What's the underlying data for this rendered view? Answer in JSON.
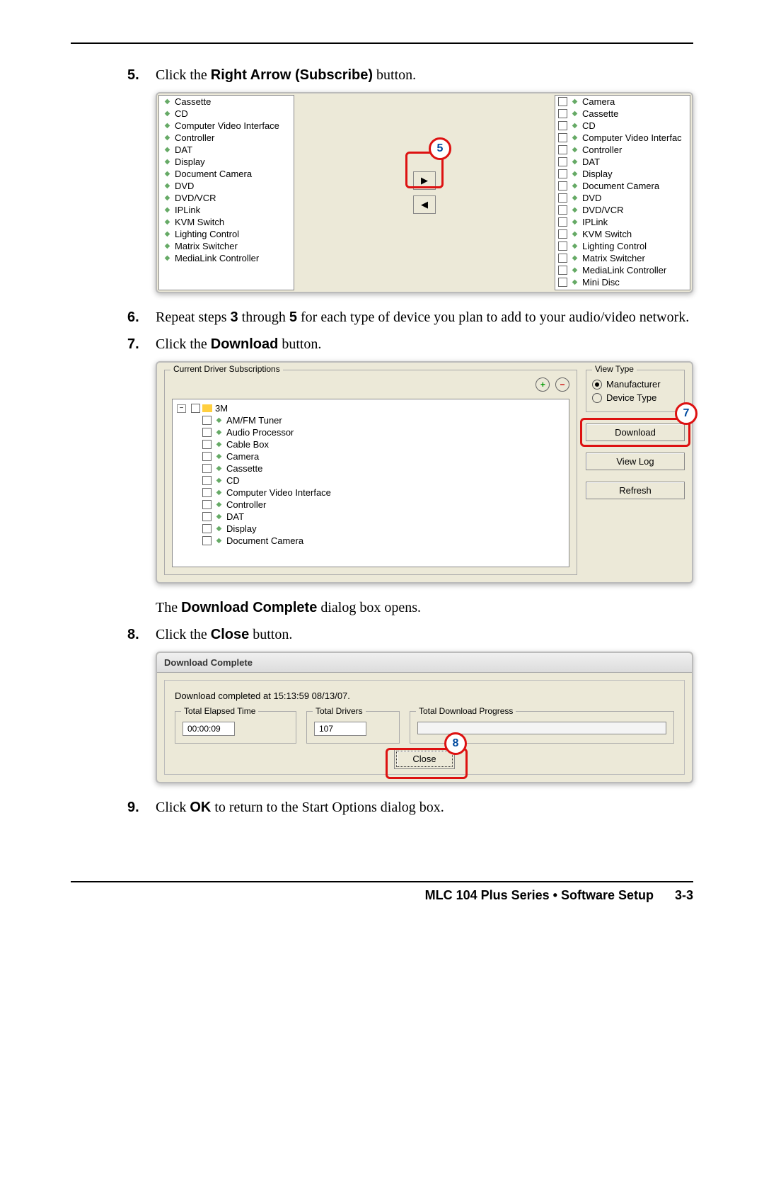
{
  "steps": {
    "s5": {
      "num": "5.",
      "pre": "Click the ",
      "bold": "Right Arrow (Subscribe)",
      "post": " button."
    },
    "s6": {
      "num": "6.",
      "pre": "Repeat steps ",
      "b1": "3",
      "mid1": " through ",
      "b2": "5",
      "post": " for each type of device you plan to add to your audio/video network."
    },
    "s7": {
      "num": "7.",
      "pre": "Click the ",
      "bold": "Download",
      "post": " button."
    },
    "s7a": {
      "pre": "The ",
      "bold": "Download Complete",
      "post": " dialog box opens."
    },
    "s8": {
      "num": "8.",
      "pre": "Click the ",
      "bold": "Close",
      "post": " button."
    },
    "s9": {
      "num": "9.",
      "pre": "Click ",
      "bold": "OK",
      "post": " to return to the Start Options dialog box."
    }
  },
  "fig1": {
    "left": [
      "Cassette",
      "CD",
      "Computer Video Interface",
      "Controller",
      "DAT",
      "Display",
      "Document Camera",
      "DVD",
      "DVD/VCR",
      "IPLink",
      "KVM Switch",
      "Lighting Control",
      "Matrix Switcher",
      "MediaLink Controller"
    ],
    "right": [
      "Camera",
      "Cassette",
      "CD",
      "Computer Video Interfac",
      "Controller",
      "DAT",
      "Display",
      "Document Camera",
      "DVD",
      "DVD/VCR",
      "IPLink",
      "KVM Switch",
      "Lighting Control",
      "Matrix Switcher",
      "MediaLink Controller",
      "Mini Disc"
    ],
    "callout": "5"
  },
  "fig2": {
    "group_label": "Current Driver Subscriptions",
    "root": "3M",
    "items": [
      "AM/FM Tuner",
      "Audio Processor",
      "Cable Box",
      "Camera",
      "Cassette",
      "CD",
      "Computer Video Interface",
      "Controller",
      "DAT",
      "Display",
      "Document Camera"
    ],
    "view_type_label": "View Type",
    "radio1": "Manufacturer",
    "radio2": "Device Type",
    "btn_download": "Download",
    "btn_viewlog": "View Log",
    "btn_refresh": "Refresh",
    "callout": "7"
  },
  "fig3": {
    "title": "Download Complete",
    "status": "Download completed at 15:13:59 08/13/07.",
    "elapsed_label": "Total Elapsed Time",
    "elapsed_value": "00:00:09",
    "drivers_label": "Total Drivers",
    "drivers_value": "107",
    "progress_label": "Total Download Progress",
    "close": "Close",
    "callout": "8"
  },
  "footer": {
    "title": "MLC 104 Plus Series • Software Setup",
    "page": "3-3"
  }
}
